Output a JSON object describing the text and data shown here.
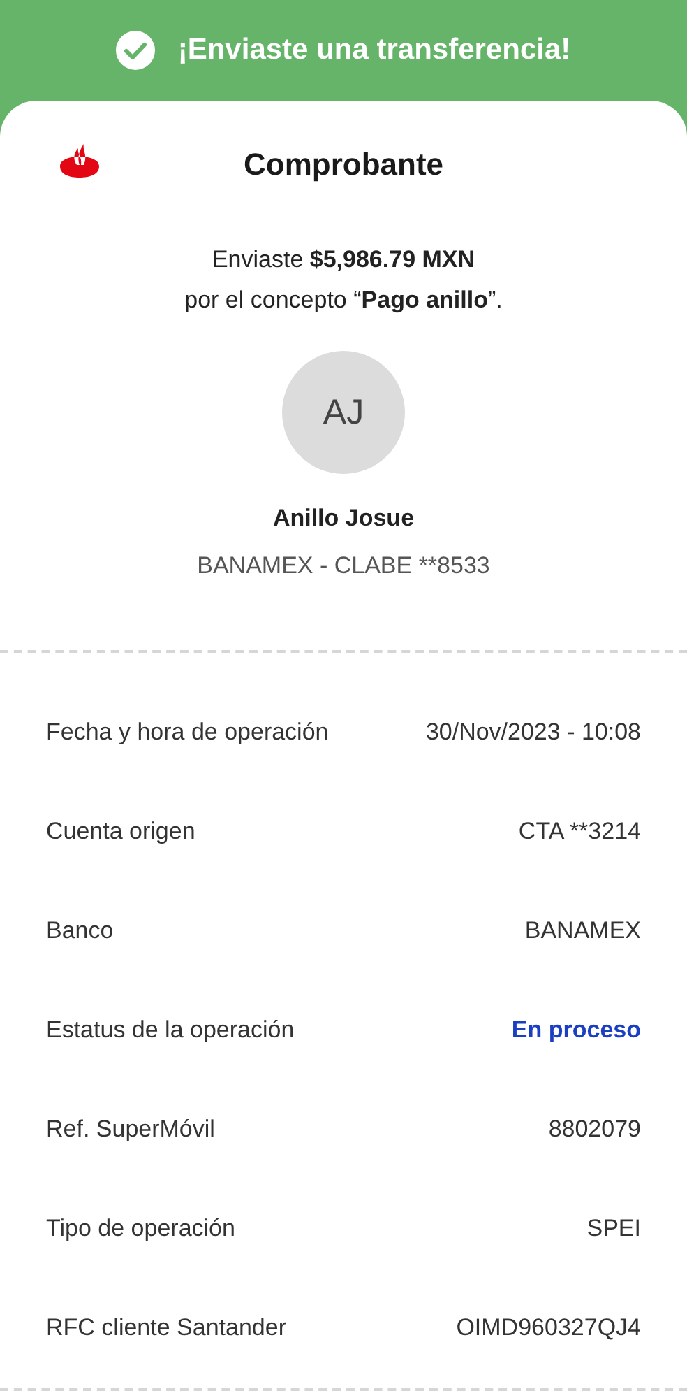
{
  "banner": {
    "title": "¡Enviaste una transferencia!"
  },
  "header": {
    "title": "Comprobante"
  },
  "summary": [
    "Enviaste **$5,986.79 MXN**",
    "por el concepto “**Pago anillo**”."
  ],
  "recipient": {
    "initials": "AJ",
    "name": "Anillo Josue",
    "account": "BANAMEX - CLABE **8533"
  },
  "details": [
    {
      "label": "Fecha y hora de operación",
      "value": "30/Nov/2023 - 10:08",
      "kind": "text"
    },
    {
      "label": "Cuenta origen",
      "value": "CTA **3214",
      "kind": "text"
    },
    {
      "label": "Banco",
      "value": "BANAMEX",
      "kind": "text"
    },
    {
      "label": "Estatus de la operación",
      "value": "En proceso",
      "kind": "status"
    },
    {
      "label": "Ref. SuperMóvil",
      "value": "8802079",
      "kind": "text"
    },
    {
      "label": "Tipo de operación",
      "value": "SPEI",
      "kind": "text"
    },
    {
      "label": "RFC cliente Santander",
      "value": "OIMD960327QJ4",
      "kind": "text"
    }
  ]
}
